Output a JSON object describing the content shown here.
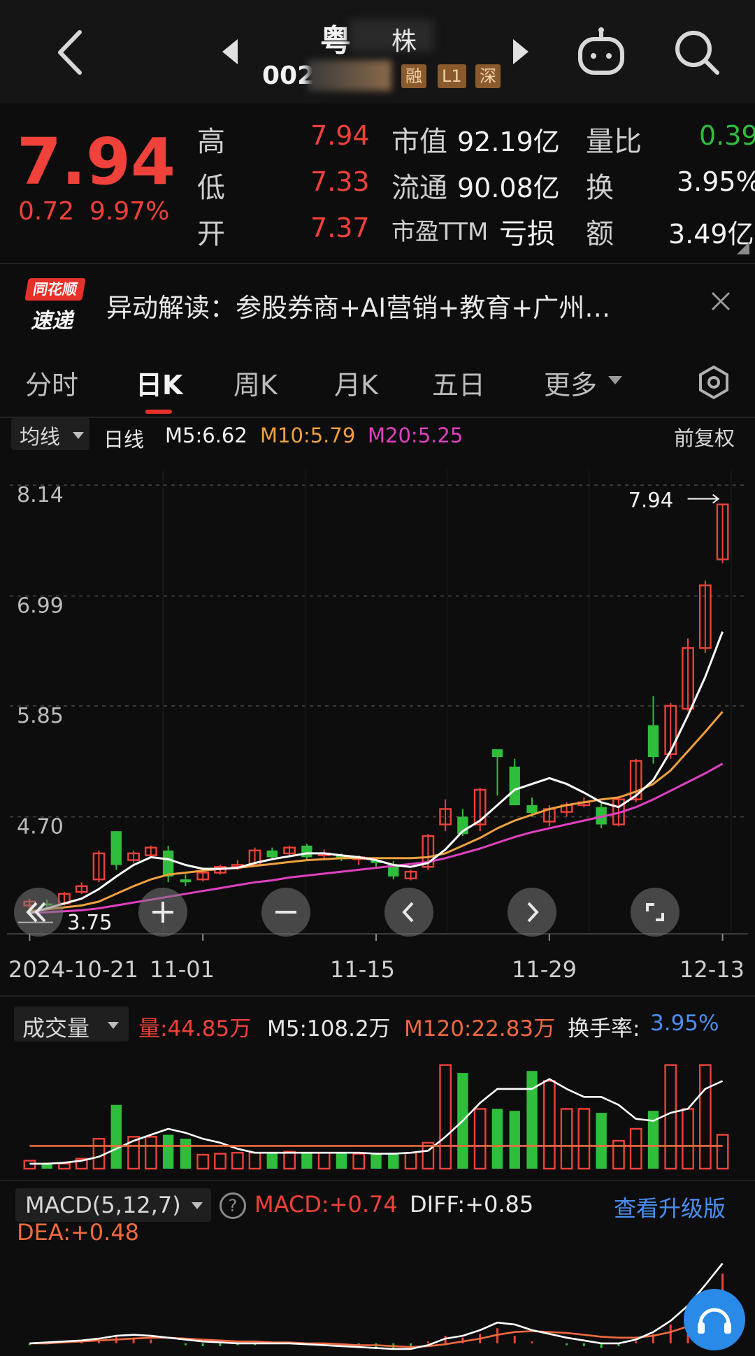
{
  "header": {
    "stock_name_left": "粤",
    "stock_name_right": "株",
    "stock_code": "002",
    "tags": [
      "融",
      "L1",
      "深"
    ]
  },
  "quote": {
    "price": "7.94",
    "change": "0.72",
    "change_pct": "9.97%",
    "high_label": "高",
    "high": "7.94",
    "low_label": "低",
    "low": "7.33",
    "open_label": "开",
    "open": "7.37",
    "mktcap_label": "市值",
    "mktcap": "92.19亿",
    "float_label": "流通",
    "float": "90.08亿",
    "pe_label": "市盈TTM",
    "pe": "亏损",
    "vr_label": "量比",
    "vr": "0.39",
    "turn_label": "换",
    "turn": "3.95%",
    "amt_label": "额",
    "amt": "3.49亿"
  },
  "news": {
    "logo_top": "同花顺",
    "logo_bottom": "速递",
    "text": "异动解读：参股券商+AI营销+教育+广州…"
  },
  "tabs": [
    "分时",
    "日K",
    "周K",
    "月K",
    "五日",
    "更多"
  ],
  "active_tab": "日K",
  "ma_bar": {
    "selector": "均线",
    "period": "日线",
    "m5": "M5:6.62",
    "m10": "M10:5.79",
    "m20": "M20:5.25",
    "adjust": "前复权"
  },
  "kline": {
    "y_ticks": [
      "8.14",
      "6.99",
      "5.85",
      "4.70"
    ],
    "max_label": "7.94",
    "min_label": "3.75",
    "x_ticks": [
      "2024-10-21",
      "11-01",
      "11-15",
      "11-29",
      "12-13"
    ]
  },
  "volume_bar": {
    "selector": "成交量",
    "vol": "量:44.85万",
    "m5": "M5:108.2万",
    "m120": "M120:22.83万",
    "turn_label": "换手率:",
    "turn": "3.95%"
  },
  "macd_bar": {
    "selector": "MACD(5,12,7)",
    "macd": "MACD:+0.74",
    "diff": "DIFF:+0.85",
    "dea": "DEA:+0.48",
    "upgrade": "查看升级版"
  },
  "colors": {
    "up": "#f0413a",
    "down": "#2fbe3c",
    "m5": "#ffffff",
    "m10": "#f0a040",
    "m20": "#e040c0",
    "link": "#4a8ff0"
  },
  "chart_data": {
    "type": "candlestick",
    "candles_ohlc": [
      [
        3.78,
        3.85,
        3.72,
        3.82
      ],
      [
        3.8,
        3.84,
        3.75,
        3.78
      ],
      [
        3.8,
        3.92,
        3.78,
        3.9
      ],
      [
        3.92,
        4.02,
        3.9,
        3.98
      ],
      [
        4.05,
        4.35,
        4.02,
        4.32
      ],
      [
        4.55,
        4.55,
        4.15,
        4.2
      ],
      [
        4.25,
        4.35,
        4.22,
        4.32
      ],
      [
        4.3,
        4.4,
        4.28,
        4.38
      ],
      [
        4.35,
        4.4,
        4.02,
        4.08
      ],
      [
        4.05,
        4.1,
        3.98,
        4.02
      ],
      [
        4.05,
        4.14,
        4.03,
        4.12
      ],
      [
        4.12,
        4.2,
        4.1,
        4.18
      ],
      [
        4.18,
        4.25,
        4.15,
        4.2
      ],
      [
        4.2,
        4.38,
        4.18,
        4.35
      ],
      [
        4.35,
        4.38,
        4.25,
        4.28
      ],
      [
        4.32,
        4.4,
        4.28,
        4.38
      ],
      [
        4.4,
        4.42,
        4.26,
        4.28
      ],
      [
        4.3,
        4.36,
        4.25,
        4.32
      ],
      [
        4.3,
        4.32,
        4.24,
        4.26
      ],
      [
        4.26,
        4.3,
        4.2,
        4.28
      ],
      [
        4.25,
        4.28,
        4.18,
        4.22
      ],
      [
        4.2,
        4.24,
        4.05,
        4.08
      ],
      [
        4.06,
        4.15,
        4.04,
        4.13
      ],
      [
        4.18,
        4.52,
        4.15,
        4.5
      ],
      [
        4.62,
        4.88,
        4.55,
        4.78
      ],
      [
        4.7,
        4.78,
        4.5,
        4.52
      ],
      [
        4.62,
        5.0,
        4.55,
        4.98
      ],
      [
        5.4,
        5.4,
        4.92,
        5.32
      ],
      [
        5.22,
        5.3,
        4.82,
        4.82
      ],
      [
        4.82,
        4.9,
        4.7,
        4.74
      ],
      [
        4.65,
        4.82,
        4.6,
        4.78
      ],
      [
        4.75,
        4.85,
        4.7,
        4.82
      ],
      [
        4.82,
        4.9,
        4.8,
        4.85
      ],
      [
        4.8,
        4.85,
        4.58,
        4.62
      ],
      [
        4.62,
        4.9,
        4.6,
        4.88
      ],
      [
        4.88,
        5.3,
        4.85,
        5.28
      ],
      [
        5.65,
        5.95,
        5.25,
        5.32
      ],
      [
        5.35,
        5.88,
        5.3,
        5.85
      ],
      [
        5.82,
        6.55,
        5.8,
        6.45
      ],
      [
        6.45,
        7.15,
        6.4,
        7.1
      ],
      [
        7.37,
        7.94,
        7.33,
        7.94
      ]
    ],
    "ma5": [
      3.7,
      3.75,
      3.8,
      3.85,
      3.95,
      4.08,
      4.2,
      4.28,
      4.26,
      4.2,
      4.16,
      4.16,
      4.17,
      4.22,
      4.26,
      4.29,
      4.32,
      4.32,
      4.3,
      4.28,
      4.25,
      4.2,
      4.18,
      4.22,
      4.36,
      4.55,
      4.66,
      4.82,
      4.98,
      5.04,
      5.1,
      5.04,
      4.95,
      4.85,
      4.8,
      4.92,
      5.08,
      5.38,
      5.75,
      6.15,
      6.62
    ],
    "ma10": [
      3.72,
      3.74,
      3.76,
      3.78,
      3.82,
      3.9,
      3.98,
      4.05,
      4.1,
      4.12,
      4.14,
      4.16,
      4.17,
      4.19,
      4.21,
      4.23,
      4.25,
      4.26,
      4.27,
      4.27,
      4.27,
      4.27,
      4.27,
      4.28,
      4.32,
      4.4,
      4.48,
      4.58,
      4.66,
      4.72,
      4.78,
      4.82,
      4.85,
      4.88,
      4.9,
      4.96,
      5.04,
      5.18,
      5.38,
      5.58,
      5.79
    ],
    "ma20": [
      3.7,
      3.71,
      3.72,
      3.73,
      3.75,
      3.78,
      3.81,
      3.84,
      3.87,
      3.9,
      3.93,
      3.96,
      3.99,
      4.02,
      4.04,
      4.07,
      4.09,
      4.11,
      4.13,
      4.15,
      4.17,
      4.19,
      4.21,
      4.23,
      4.27,
      4.32,
      4.37,
      4.43,
      4.49,
      4.54,
      4.58,
      4.62,
      4.66,
      4.7,
      4.74,
      4.8,
      4.88,
      4.97,
      5.06,
      5.15,
      5.25
    ],
    "volume": [
      8,
      6,
      5,
      10,
      30,
      64,
      32,
      32,
      34,
      30,
      14,
      15,
      16,
      16,
      16,
      17,
      16,
      16,
      16,
      15,
      15,
      16,
      16,
      26,
      104,
      96,
      60,
      60,
      58,
      98,
      88,
      60,
      60,
      56,
      28,
      40,
      58,
      104,
      60,
      104,
      34
    ],
    "volume_ma5": [
      5,
      5,
      6,
      8,
      12,
      20,
      28,
      34,
      40,
      36,
      30,
      26,
      20,
      16,
      16,
      16,
      16,
      16,
      16,
      16,
      15,
      15,
      16,
      18,
      32,
      48,
      66,
      80,
      80,
      80,
      90,
      80,
      72,
      72,
      64,
      50,
      48,
      56,
      60,
      80,
      88
    ],
    "macd_hist": [
      -0.02,
      -0.01,
      0.0,
      0.02,
      0.05,
      0.08,
      0.06,
      0.04,
      0.0,
      -0.02,
      -0.03,
      -0.03,
      -0.02,
      -0.02,
      -0.01,
      0.0,
      -0.01,
      -0.02,
      -0.03,
      -0.04,
      -0.05,
      -0.06,
      -0.05,
      0.02,
      0.08,
      0.06,
      0.1,
      0.16,
      0.08,
      0.02,
      0.0,
      -0.02,
      -0.03,
      -0.05,
      -0.03,
      0.02,
      0.1,
      0.2,
      0.35,
      0.55,
      0.74
    ],
    "diff": [
      0.0,
      0.01,
      0.02,
      0.03,
      0.05,
      0.08,
      0.09,
      0.08,
      0.06,
      0.04,
      0.02,
      0.01,
      0.0,
      0.0,
      0.0,
      0.0,
      -0.01,
      -0.02,
      -0.03,
      -0.04,
      -0.05,
      -0.06,
      -0.06,
      -0.02,
      0.05,
      0.08,
      0.14,
      0.22,
      0.2,
      0.14,
      0.1,
      0.06,
      0.03,
      0.0,
      0.0,
      0.04,
      0.12,
      0.24,
      0.4,
      0.62,
      0.85
    ],
    "dea": [
      0.0,
      0.0,
      0.01,
      0.02,
      0.03,
      0.04,
      0.05,
      0.06,
      0.06,
      0.05,
      0.04,
      0.03,
      0.02,
      0.02,
      0.01,
      0.01,
      0.0,
      0.0,
      -0.01,
      -0.02,
      -0.02,
      -0.03,
      -0.04,
      -0.03,
      -0.01,
      0.02,
      0.05,
      0.09,
      0.12,
      0.13,
      0.12,
      0.11,
      0.09,
      0.07,
      0.06,
      0.06,
      0.08,
      0.12,
      0.18,
      0.3,
      0.48
    ],
    "price_axis": [
      3.5,
      8.3
    ],
    "y_ticks": [
      "8.14",
      "6.99",
      "5.85",
      "4.70"
    ],
    "x_labels": [
      "2024-10-21",
      "11-01",
      "11-15",
      "11-29",
      "12-13"
    ]
  }
}
